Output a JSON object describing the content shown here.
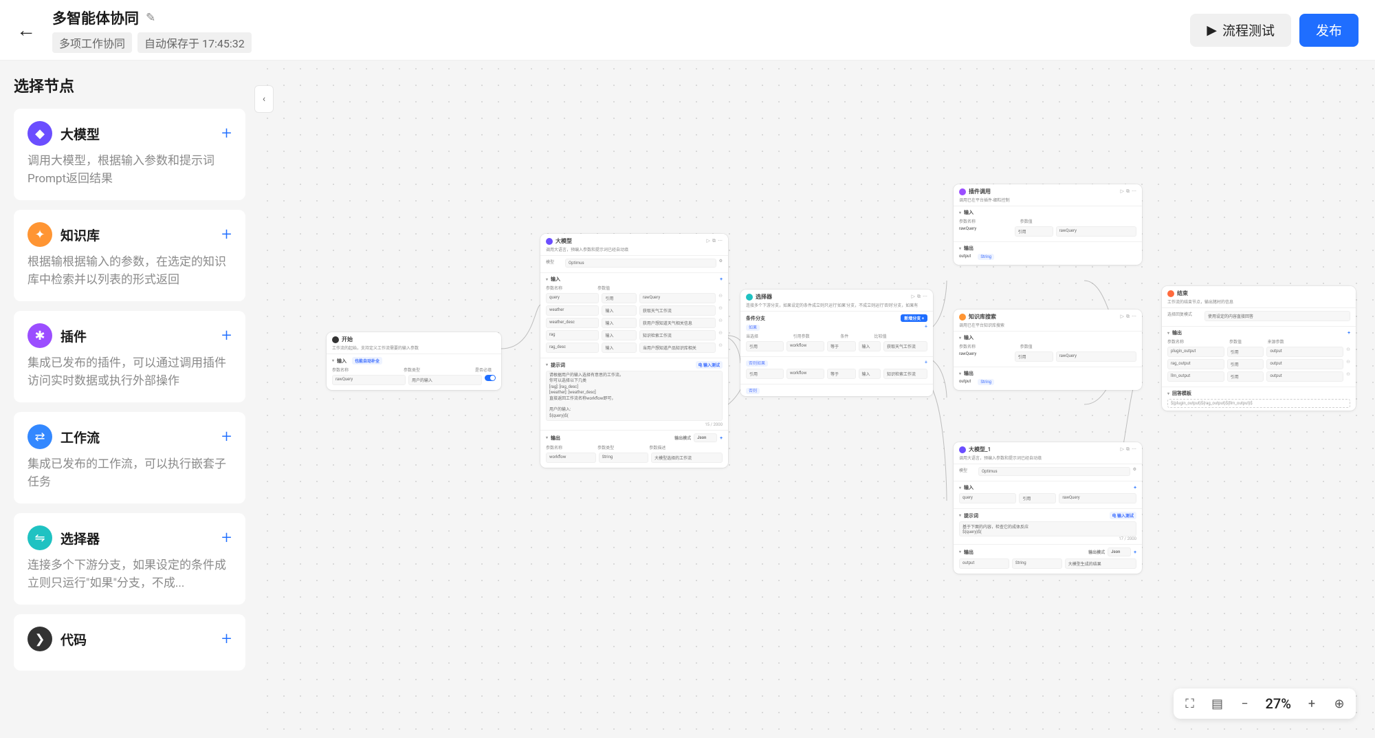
{
  "header": {
    "title": "多智能体协同",
    "tag": "多项工作协同",
    "autosave": "自动保存于 17:45:32",
    "btn_test": "流程测试",
    "btn_publish": "发布"
  },
  "sidebar": {
    "title": "选择节点",
    "items": [
      {
        "name": "大模型",
        "desc": "调用大模型，根据输入参数和提示词Prompt返回结果",
        "color": "ic-purple",
        "glyph": "◆"
      },
      {
        "name": "知识库",
        "desc": "根据输根据输入的参数，在选定的知识库中检索并以列表的形式返回",
        "color": "ic-orange",
        "glyph": "✦"
      },
      {
        "name": "插件",
        "desc": "集成已发布的插件，可以通过调用插件访问实时数据或执行外部操作",
        "color": "ic-violet",
        "glyph": "✱"
      },
      {
        "name": "工作流",
        "desc": "集成已发布的工作流，可以执行嵌套子任务",
        "color": "ic-blue",
        "glyph": "⇄"
      },
      {
        "name": "选择器",
        "desc": "连接多个下游分支，如果设定的条件成立则只运行\"如果\"分支，不成...",
        "color": "ic-teal",
        "glyph": "⇋"
      },
      {
        "name": "代码",
        "desc": "",
        "color": "ic-dark",
        "glyph": "❯"
      }
    ]
  },
  "zoom": {
    "pct": "27%"
  },
  "flow": {
    "start": {
      "title": "开始",
      "sub": "工作流的起始，支持定义工作流需要的输入参数",
      "sec_input": "输入",
      "label_auto": "也能自动补全",
      "h_name": "参数名称",
      "h_type": "参数类型",
      "h_req": "是否必填",
      "row_name": "rawQuery",
      "row_type": "用户的输入"
    },
    "llm": {
      "title": "大模型",
      "sub": "调用大语言，预编入参数和提示词已经自动填",
      "model_label": "模型",
      "model_value": "Optimus",
      "sec_input": "输入",
      "h_name": "参数名称",
      "h_type": "参数值",
      "h_ref": "",
      "rows": [
        {
          "n": "query",
          "t": "引用",
          "v": "rawQuery"
        },
        {
          "n": "weather",
          "t": "输入",
          "v": "获取天气工作流"
        },
        {
          "n": "weather_desc",
          "t": "输入",
          "v": "获用户想知道天气相关信息"
        },
        {
          "n": "rag",
          "t": "输入",
          "v": "知识检索工作流"
        },
        {
          "n": "rag_desc",
          "t": "输入",
          "v": "当用户想知道产品知识库相关"
        }
      ],
      "sec_prompt": "提示词",
      "prompt_btn": "电 输入测试",
      "prompt_body": "请根据用户的输入选择有意思的工作流。\n你可以选择以下几类\n[rag]: [rag_desc]\n[weather]: [weather_desc]\n直接返回工作流名称workflow即可，\n\n用户的输入:\n${query}${",
      "prompt_count": "15 / 2000",
      "sec_output": "输出",
      "out_mode_label": "输出模式",
      "out_mode_value": "Json",
      "h_out_name": "参数名称",
      "h_out_type": "参数类型",
      "h_out_desc": "参数描述",
      "out_name": "workflow",
      "out_type": "String",
      "out_desc": "大模型选择的工作流"
    },
    "selector": {
      "title": "选择器",
      "sub": "连接多个下游分支，如果设定的条件成立则只运行'如果'分支，不成立则运行'否则'分支，如果有",
      "cond_title": "条件分支",
      "btn_add_branch": "新增分支 +",
      "if_label": "如果",
      "h_when": "当选择",
      "h_ref": "引用参数",
      "h_cond": "条件",
      "h_val": "比较值",
      "r1_ref": "workflow",
      "r1_select": "等于",
      "r1_ref2": "输入",
      "r1_val": "获取天气工作流",
      "elseif_label": "否则如果",
      "r2_ref": "workflow",
      "r2_select": "等于",
      "r2_ref2": "输入",
      "r2_val": "知识检索工作流",
      "else_label": "否则"
    },
    "plugin": {
      "title": "插件调用",
      "sub": "调用已在平台插件-细粒控制",
      "sec_input": "输入",
      "h_name": "参数名称",
      "h_type": "参数值",
      "row_name": "rawQuery",
      "row_t": "引用",
      "row_v": "rawQuery",
      "sec_output": "输出",
      "out_name": "output",
      "out_type": "String"
    },
    "kb": {
      "title": "知识库搜索",
      "sub": "调用已在平台知识库搜索",
      "sec_input": "输入",
      "h_name": "参数名称",
      "h_type": "参数值",
      "row_name": "rawQuery",
      "row_t": "引用",
      "row_v": "rawQuery",
      "sec_output": "输出",
      "out_name": "output",
      "out_type": "String"
    },
    "llm2": {
      "title": "大模型_1",
      "sub": "调用大语言，预编入参数和提示词已经自动填",
      "model_label": "模型",
      "model_value": "Optimus",
      "sec_input": "输入",
      "h_name": "参数名称",
      "h_type": "参数值",
      "row_name": "query",
      "row_t": "引用",
      "row_v": "rawQuery",
      "sec_prompt": "提示词",
      "prompt_btn": "电 输入测试",
      "prompt_body": "基于下面的内容，检查它的成体反应\n${query}${",
      "prompt_count": "17 / 2000",
      "sec_output": "输出",
      "out_mode_label": "输出模式",
      "out_mode_value": "Json",
      "h_on": "参数名称",
      "h_ot": "参数类型",
      "h_od": "参数描述",
      "out_name": "output",
      "out_type": "String",
      "out_desc": "大模型生成的结果"
    },
    "end": {
      "title": "结束",
      "sub": "工作流的结束节点，输出猪村的信息",
      "mode_label": "选择回复模式",
      "mode_value": "使用设定的内容直接回答",
      "sec_output": "输出",
      "h_name": "参数名称",
      "h_type": "参数值",
      "h_ref": "来源参数",
      "rows": [
        {
          "n": "plugin_output",
          "t": "引用",
          "v": "output"
        },
        {
          "n": "rag_output",
          "t": "引用",
          "v": "output"
        },
        {
          "n": "llm_output",
          "t": "引用",
          "v": "output"
        }
      ],
      "sec_template": "回答模板",
      "template_body": "${plugin_output}${rag_output}${llm_output}$"
    }
  }
}
